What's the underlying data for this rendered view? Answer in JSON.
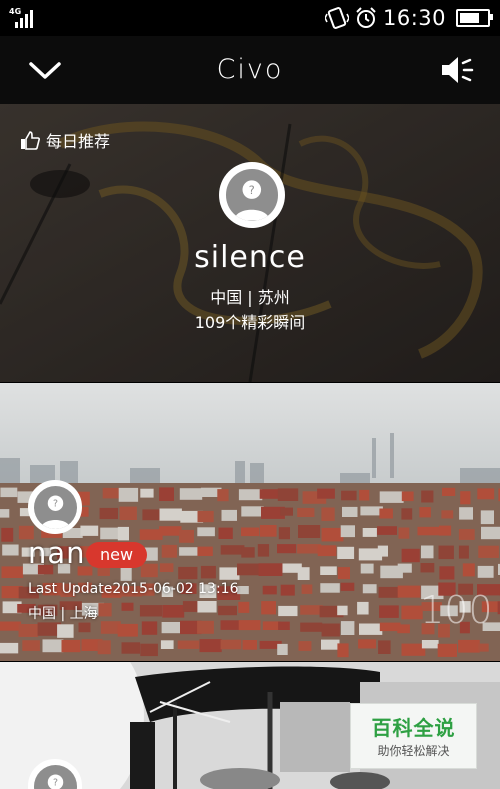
{
  "status_bar": {
    "network": "4G",
    "time": "16:30",
    "icons": [
      "signal-icon",
      "vibrate-icon",
      "alarm-icon",
      "battery-icon"
    ],
    "battery_level": 0.85
  },
  "app_bar": {
    "title": "Civo",
    "left_icon": "chevron-down-icon",
    "right_icon": "speaker-icon"
  },
  "feed": {
    "cards": [
      {
        "tag": "每日推荐",
        "tag_icon": "thumbs-up-icon",
        "name": "silence",
        "location": "中国 | 苏州",
        "moments": "109个精彩瞬间"
      },
      {
        "name": "nan",
        "badge": "new",
        "last_update": "Last Update2015-06-02 13:16",
        "location": "中国 | 上海",
        "count": "100"
      },
      {
        "name": ""
      }
    ]
  },
  "watermark": {
    "title": "百科全说",
    "subtitle": "助你轻松解决"
  },
  "colors": {
    "badge": "#d8372d",
    "watermark_green": "#2ea043"
  }
}
